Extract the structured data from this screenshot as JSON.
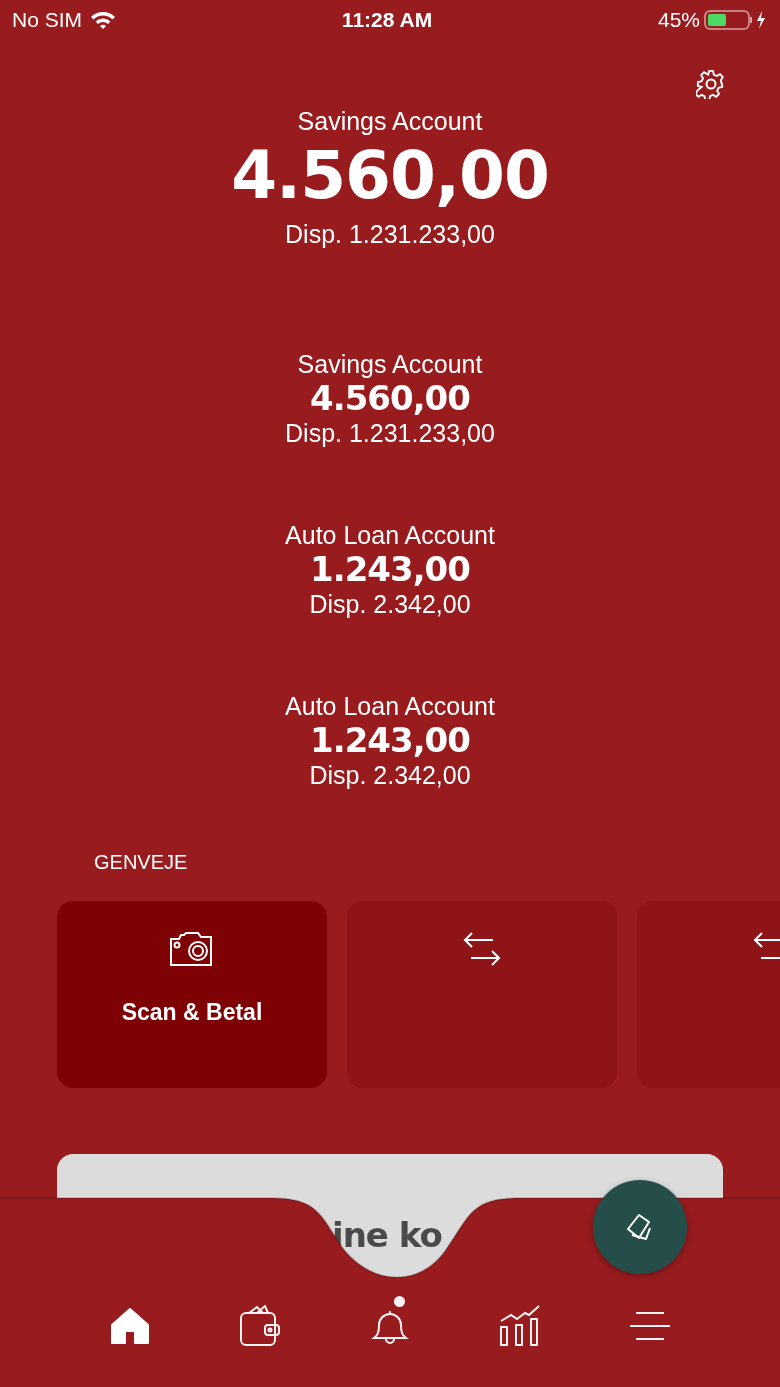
{
  "status_bar": {
    "carrier": "No SIM",
    "time": "11:28 AM",
    "battery": "45%"
  },
  "accounts": [
    {
      "kind": "primary",
      "name": "Savings Account",
      "balance": "4.560,00",
      "available": "Disp. 1.231.233,00"
    },
    {
      "kind": "secondary",
      "name": "Savings Account",
      "balance": "4.560,00",
      "available": "Disp. 1.231.233,00"
    },
    {
      "kind": "secondary",
      "name": "Auto Loan Account",
      "balance": "1.243,00",
      "available": "Disp. 2.342,00"
    },
    {
      "kind": "secondary",
      "name": "Auto Loan Account",
      "balance": "1.243,00",
      "available": "Disp. 2.342,00"
    }
  ],
  "shortcuts": {
    "title": "GENVEJE",
    "items": [
      {
        "kind": "camera",
        "label": "Scan & Betal",
        "selected": true
      },
      {
        "kind": "transfer",
        "selected": false
      },
      {
        "kind": "transfer",
        "selected": false
      }
    ]
  },
  "promo_card": {
    "text": "ine ko"
  },
  "tab_bar": {
    "items": [
      {
        "kind": "home",
        "selected": true,
        "badge": false
      },
      {
        "kind": "wallet",
        "selected": false,
        "badge": false
      },
      {
        "kind": "bell",
        "selected": false,
        "badge": true
      },
      {
        "kind": "chart",
        "selected": false,
        "badge": false
      },
      {
        "kind": "menu",
        "selected": false,
        "badge": false
      }
    ]
  }
}
